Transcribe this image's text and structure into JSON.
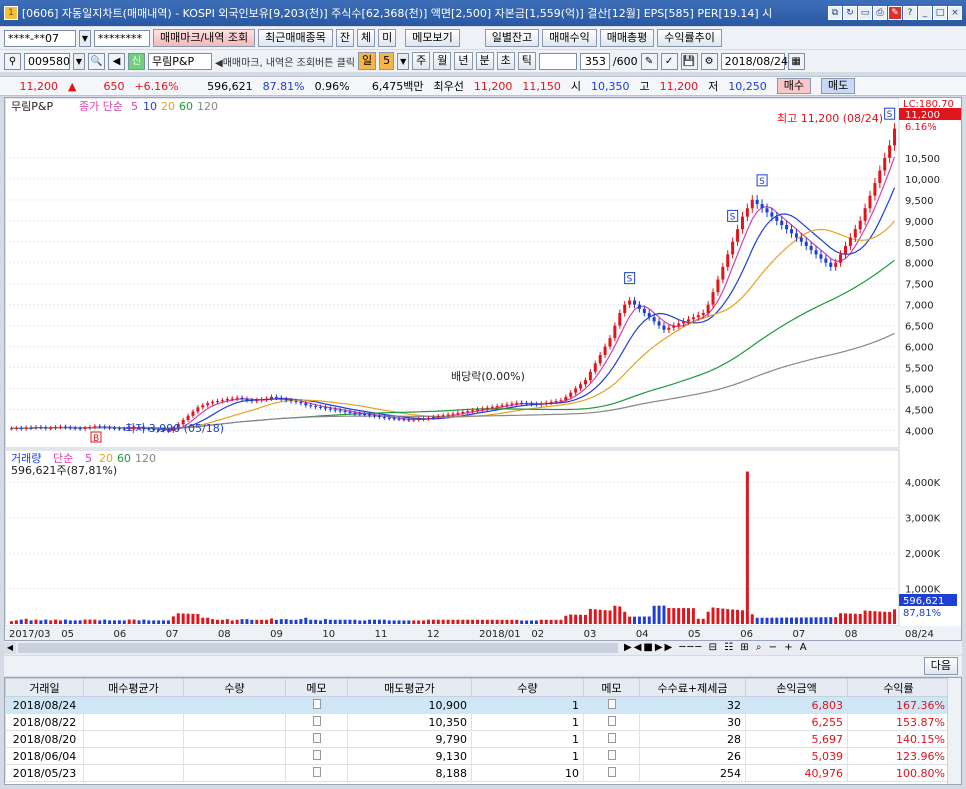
{
  "window": {
    "app_code": "[0606]",
    "title": "[0606] 자동일지차트(매매내역) - KOSPI 외국인보유[9,203(천)] 주식수[62,368(천)] 액면[2,500] 자본금[1,559(억)] 결산[12월] EPS[585] PER[19.14] 시"
  },
  "toolbar1": {
    "account": "****-**07",
    "password": "********",
    "buttons": [
      "매매마크/내역 조회",
      "최근매매종목",
      "잔",
      "체",
      "미",
      "메모보기",
      "일별잔고",
      "매매수익",
      "매매총평",
      "수익률추이"
    ]
  },
  "toolbar2": {
    "code": "009580",
    "credit_tag": "신",
    "stock_name": "무림P&P",
    "hint": "◀매매마크, 내역은 조회버튼 클릭",
    "period_label": "일",
    "period_value": "5",
    "periods": [
      "주",
      "월",
      "년",
      "분",
      "초",
      "틱"
    ],
    "count": "353",
    "count_max": "/600",
    "date": "2018/08/24"
  },
  "quote": {
    "price": "11,200",
    "arrow": "▲",
    "change": "650",
    "change_pct": "+6.16%",
    "volume": "596,621",
    "volume_ratio": "87.81%",
    "turnover": "0.96%",
    "amount": "6,475백만",
    "best_label": "최우선",
    "ask": "11,200",
    "bid": "11,150",
    "open_label": "시",
    "open": "10,350",
    "high_label": "고",
    "high": "11,200",
    "low_label": "저",
    "low": "10,250",
    "buy_label": "매수",
    "sell_label": "매도"
  },
  "chart_data": {
    "type": "candlestick",
    "price_panel": {
      "legend": [
        "무림P&P",
        "종가 단순",
        "5",
        "10",
        "20",
        "60",
        "120"
      ],
      "y_ticks": [
        "10,500",
        "10,000",
        "9,500",
        "9,000",
        "8,500",
        "8,000",
        "7,500",
        "7,000",
        "6,500",
        "6,000",
        "5,500",
        "5,000",
        "4,500",
        "4,000"
      ],
      "ylim": [
        3700,
        11500
      ],
      "lc_label": "LC:180.70",
      "current_label": "11,200",
      "current_pct": "6.16%",
      "high_annotation": "최고 11,200 (08/24)",
      "low_annotation": "최저 3,990 (05/18)",
      "dividend_annotation": "배당락(0.00%)",
      "marker_b": "B",
      "marker_s": "S",
      "closes": [
        4050,
        4060,
        4040,
        4070,
        4060,
        4080,
        4070,
        4050,
        4060,
        4080,
        4090,
        4070,
        4060,
        4050,
        4040,
        4060,
        4080,
        4100,
        4090,
        4070,
        4060,
        4050,
        4040,
        4030,
        4050,
        4070,
        4060,
        4040,
        4030,
        4020,
        4010,
        4000,
        3990,
        4050,
        4150,
        4250,
        4350,
        4450,
        4550,
        4600,
        4650,
        4680,
        4700,
        4720,
        4750,
        4760,
        4780,
        4750,
        4720,
        4700,
        4720,
        4740,
        4760,
        4800,
        4780,
        4750,
        4720,
        4700,
        4680,
        4650,
        4600,
        4580,
        4560,
        4550,
        4520,
        4500,
        4480,
        4460,
        4440,
        4420,
        4400,
        4390,
        4380,
        4360,
        4340,
        4320,
        4300,
        4290,
        4280,
        4270,
        4260,
        4250,
        4260,
        4270,
        4280,
        4300,
        4320,
        4340,
        4360,
        4380,
        4400,
        4420,
        4440,
        4460,
        4480,
        4500,
        4520,
        4540,
        4560,
        4580,
        4600,
        4620,
        4640,
        4660,
        4650,
        4640,
        4630,
        4620,
        4640,
        4660,
        4680,
        4700,
        4720,
        4800,
        4900,
        5000,
        5100,
        5200,
        5400,
        5600,
        5800,
        6000,
        6200,
        6500,
        6800,
        7000,
        7100,
        7000,
        6900,
        6800,
        6700,
        6600,
        6500,
        6400,
        6450,
        6500,
        6550,
        6600,
        6650,
        6700,
        6750,
        6800,
        7000,
        7300,
        7600,
        7900,
        8200,
        8500,
        8800,
        9100,
        9300,
        9500,
        9400,
        9300,
        9200,
        9100,
        9000,
        8900,
        8800,
        8700,
        8600,
        8500,
        8400,
        8300,
        8200,
        8100,
        8000,
        7900,
        8000,
        8200,
        8400,
        8600,
        8800,
        9000,
        9300,
        9600,
        9900,
        10200,
        10500,
        10800,
        11200
      ]
    },
    "volume_panel": {
      "legend": [
        "거래량",
        "단순",
        "5",
        "20",
        "60",
        "120"
      ],
      "summary": "596,621주(87,81%)",
      "y_ticks": [
        "4,000K",
        "3,000K",
        "2,000K",
        "1,000K"
      ],
      "ylim": [
        0,
        4400
      ],
      "current_label": "596,621",
      "current_pct": "87,81%"
    },
    "x_ticks": [
      "2017/03",
      "05",
      "06",
      "07",
      "08",
      "09",
      "10",
      "11",
      "12",
      "2018/01",
      "02",
      "03",
      "04",
      "05",
      "06",
      "07",
      "08",
      "08/24"
    ]
  },
  "next_button": "다음",
  "table": {
    "headers": [
      "거래일",
      "매수평균가",
      "수량",
      "메모",
      "매도평균가",
      "수량",
      "메모",
      "수수료+제세금",
      "손익금액",
      "수익률"
    ],
    "rows": [
      {
        "date": "2018/08/24",
        "buy_avg": "",
        "buy_qty": "",
        "sell_avg": "10,900",
        "sell_qty": "1",
        "fee": "32",
        "pnl": "6,803",
        "ret": "167.36%"
      },
      {
        "date": "2018/08/22",
        "buy_avg": "",
        "buy_qty": "",
        "sell_avg": "10,350",
        "sell_qty": "1",
        "fee": "30",
        "pnl": "6,255",
        "ret": "153.87%"
      },
      {
        "date": "2018/08/20",
        "buy_avg": "",
        "buy_qty": "",
        "sell_avg": "9,790",
        "sell_qty": "1",
        "fee": "28",
        "pnl": "5,697",
        "ret": "140.15%"
      },
      {
        "date": "2018/06/04",
        "buy_avg": "",
        "buy_qty": "",
        "sell_avg": "9,130",
        "sell_qty": "1",
        "fee": "26",
        "pnl": "5,039",
        "ret": "123.96%"
      },
      {
        "date": "2018/05/23",
        "buy_avg": "",
        "buy_qty": "",
        "sell_avg": "8,188",
        "sell_qty": "10",
        "fee": "254",
        "pnl": "40,976",
        "ret": "100.80%"
      }
    ]
  }
}
